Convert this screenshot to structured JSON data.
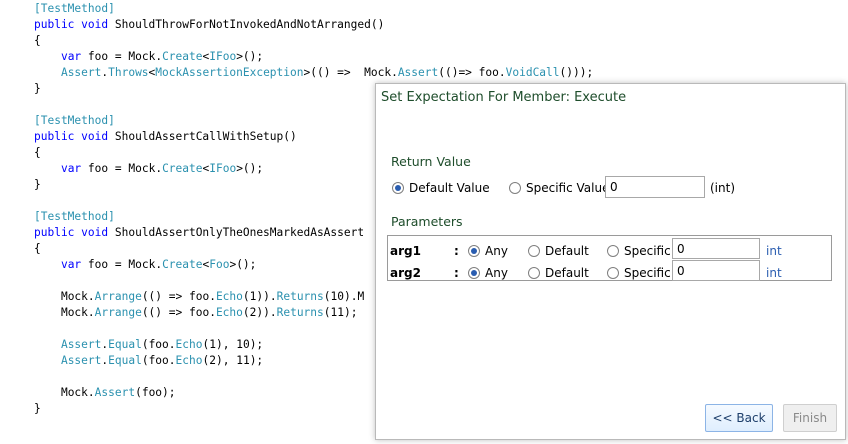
{
  "code": {
    "lines": [
      [
        "[TestMethod]"
      ],
      [
        "public void ShouldThrowForNotInvokedAndNotArranged()"
      ],
      [
        "{"
      ],
      [
        "    var foo = Mock.Create<IFoo>();"
      ],
      [
        "    Assert.Throws<MockAssertionException>(() =>  Mock.Assert(()=> foo.VoidCall()));"
      ],
      [
        "}"
      ],
      [
        ""
      ],
      [
        "[TestMethod]"
      ],
      [
        "public void ShouldAssertCallWithSetup()"
      ],
      [
        "{"
      ],
      [
        "    var foo = Mock.Create<IFoo>();"
      ],
      [
        "}"
      ],
      [
        ""
      ],
      [
        "[TestMethod]"
      ],
      [
        "public void ShouldAssertOnlyTheOnesMarkedAsAssert"
      ],
      [
        "{"
      ],
      [
        "    var foo = Mock.Create<Foo>();"
      ],
      [
        ""
      ],
      [
        "    Mock.Arrange(() => foo.Echo(1)).Returns(10).M"
      ],
      [
        "    Mock.Arrange(() => foo.Echo(2)).Returns(11);"
      ],
      [
        ""
      ],
      [
        "    Assert.Equal(foo.Echo(1), 10);"
      ],
      [
        "    Assert.Equal(foo.Echo(2), 11);"
      ],
      [
        ""
      ],
      [
        "    Mock.Assert(foo);"
      ],
      [
        "}"
      ]
    ]
  },
  "dialog": {
    "title": "Set Expectation For Member: Execute",
    "return_value": {
      "heading": "Return Value",
      "default_label": "Default Value",
      "specific_label": "Specific Value:",
      "specific_value": "0",
      "type_hint": "(int)"
    },
    "parameters": {
      "heading": "Parameters",
      "rows": [
        {
          "name": "arg1",
          "colon": ":",
          "any": "Any",
          "default": "Default",
          "specific": "Specific:",
          "value": "0",
          "type": "int"
        },
        {
          "name": "arg2",
          "colon": ":",
          "any": "Any",
          "default": "Default",
          "specific": "Specific:",
          "value": "0",
          "type": "int"
        }
      ]
    },
    "buttons": {
      "back": "<< Back",
      "finish": "Finish"
    }
  }
}
